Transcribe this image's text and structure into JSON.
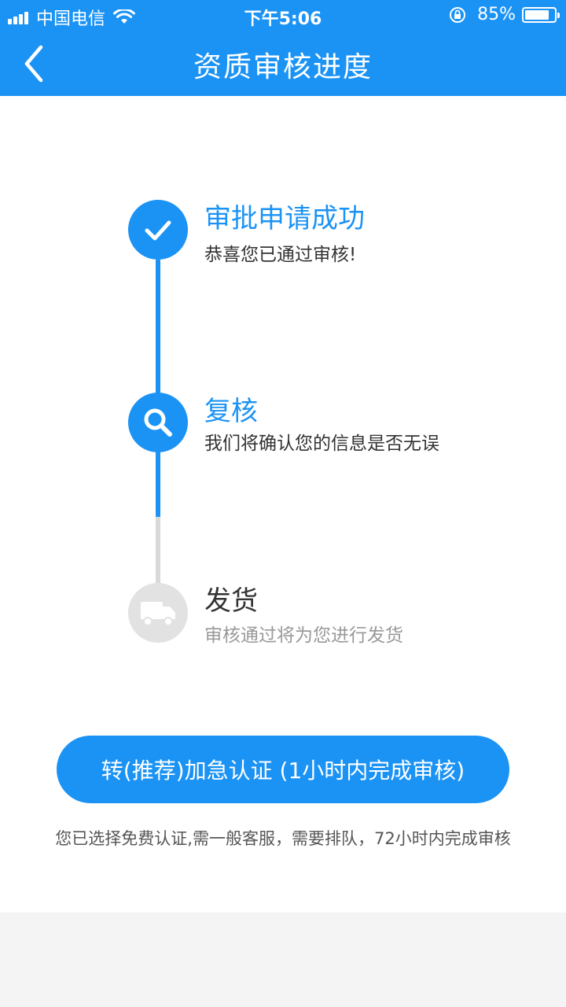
{
  "status_bar": {
    "carrier": "中国电信",
    "time": "下午5:06",
    "battery_percent": "85%",
    "battery_level": 0.85,
    "icons": [
      "signal-icon",
      "wifi-icon",
      "rotation-lock-icon",
      "battery-icon"
    ]
  },
  "nav": {
    "title": "资质审核进度",
    "back_icon": "chevron-left-icon"
  },
  "steps": [
    {
      "title": "审批申请成功",
      "desc": "恭喜您已通过审核!",
      "icon": "check-icon",
      "state": "done"
    },
    {
      "title": "复核",
      "desc": "我们将确认您的信息是否无误",
      "icon": "search-icon",
      "state": "current"
    },
    {
      "title": "发货",
      "desc": "审核通过将为您进行发货",
      "icon": "truck-icon",
      "state": "pending"
    }
  ],
  "cta": {
    "label": "转(推荐)加急认证 (1小时内完成审核)"
  },
  "note": "您已选择免费认证,需一般客服，需要排队，72小时内完成审核",
  "colors": {
    "primary": "#1b93f5",
    "inactive": "#e2e2e2",
    "text_dark": "#333333",
    "text_gray": "#999999"
  }
}
